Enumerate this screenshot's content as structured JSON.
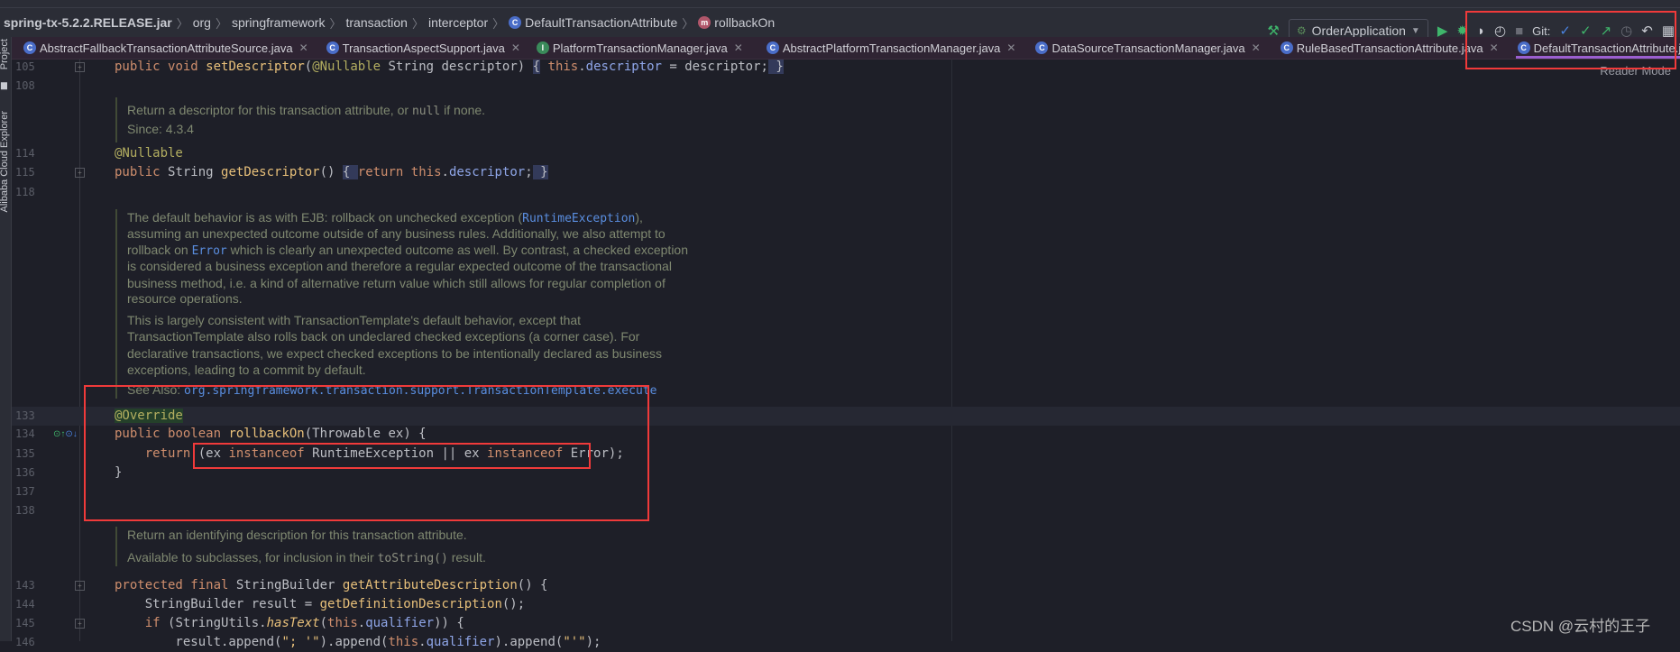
{
  "breadcrumb": {
    "jar": "spring-tx-5.2.2.RELEASE.jar",
    "parts": [
      "org",
      "springframework",
      "transaction",
      "interceptor"
    ],
    "class_name": "DefaultTransactionAttribute",
    "method_name": "rollbackOn"
  },
  "toolbar": {
    "run_config": "OrderApplication",
    "git_label": "Git:",
    "icons": [
      "build-hammer-icon",
      "run-icon",
      "debug-icon",
      "coverage-icon",
      "profile-icon",
      "stop-icon",
      "git-update-icon",
      "git-commit-icon",
      "git-push-icon",
      "history-icon",
      "rollback-icon",
      "project-structure-icon"
    ]
  },
  "tabs": [
    {
      "label": "AbstractFallbackTransactionAttributeSource.java",
      "kind": "C"
    },
    {
      "label": "TransactionAspectSupport.java",
      "kind": "C"
    },
    {
      "label": "PlatformTransactionManager.java",
      "kind": "I"
    },
    {
      "label": "AbstractPlatformTransactionManager.java",
      "kind": "C"
    },
    {
      "label": "DataSourceTransactionManager.java",
      "kind": "C"
    },
    {
      "label": "RuleBasedTransactionAttribute.java",
      "kind": "C"
    },
    {
      "label": "DefaultTransactionAttribute.java",
      "kind": "C",
      "active": true
    }
  ],
  "side_panels": [
    "Project",
    "Alibaba Cloud Explorer"
  ],
  "reader_mode": "Reader Mode",
  "code_lines": [
    {
      "n": "105",
      "fold": true,
      "tokens": [
        [
          "public ",
          "kw"
        ],
        [
          "void ",
          "kw"
        ],
        [
          "setDescriptor",
          "fn"
        ],
        [
          "(",
          "pl"
        ],
        [
          "@Nullable ",
          "an"
        ],
        [
          "String descriptor) ",
          "pl"
        ],
        [
          "{",
          "br"
        ],
        [
          " ",
          "pl"
        ],
        [
          "this",
          "kw"
        ],
        [
          ".",
          "pl"
        ],
        [
          "descriptor",
          "fld"
        ],
        [
          " = descriptor;",
          "pl"
        ],
        [
          " }",
          "br"
        ]
      ]
    },
    {
      "n": "108",
      "tokens": []
    },
    {
      "n": "114",
      "tokens": [
        [
          "@Nullable",
          "an"
        ]
      ]
    },
    {
      "n": "115",
      "fold": true,
      "tokens": [
        [
          "public ",
          "kw"
        ],
        [
          "String ",
          "pl"
        ],
        [
          "getDescriptor",
          "fn"
        ],
        [
          "() ",
          "pl"
        ],
        [
          "{ ",
          "br"
        ],
        [
          "return ",
          "kw"
        ],
        [
          "this",
          "kw"
        ],
        [
          ".",
          "pl"
        ],
        [
          "descriptor",
          "fld"
        ],
        [
          ";",
          "pl"
        ],
        [
          " }",
          "br"
        ]
      ]
    },
    {
      "n": "118",
      "tokens": []
    },
    {
      "n": "133",
      "current": true,
      "tokens": [
        [
          "@Override",
          "ov"
        ]
      ]
    },
    {
      "n": "134",
      "tokens": [
        [
          "public ",
          "kw"
        ],
        [
          "boolean ",
          "kw"
        ],
        [
          "rollbackOn",
          "fn"
        ],
        [
          "(Throwable ex) {",
          "pl"
        ]
      ]
    },
    {
      "n": "135",
      "tokens": [
        [
          "    return ",
          "kw"
        ],
        [
          "(ex ",
          "pl"
        ],
        [
          "instanceof ",
          "kw"
        ],
        [
          "RuntimeException || ex ",
          "pl"
        ],
        [
          "instanceof ",
          "kw"
        ],
        [
          "Error);",
          "pl"
        ]
      ]
    },
    {
      "n": "136",
      "tokens": [
        [
          "}",
          "pl"
        ]
      ]
    },
    {
      "n": "137",
      "tokens": []
    },
    {
      "n": "138",
      "tokens": []
    },
    {
      "n": "143",
      "fold": true,
      "tokens": [
        [
          "protected ",
          "kw"
        ],
        [
          "final ",
          "kw"
        ],
        [
          "StringBuilder ",
          "pl"
        ],
        [
          "getAttributeDescription",
          "fn"
        ],
        [
          "() {",
          "pl"
        ]
      ]
    },
    {
      "n": "144",
      "tokens": [
        [
          "    StringBuilder result = ",
          "pl"
        ],
        [
          "getDefinitionDescription",
          "fn"
        ],
        [
          "();",
          "pl"
        ]
      ]
    },
    {
      "n": "145",
      "fold": true,
      "tokens": [
        [
          "    if ",
          "kw"
        ],
        [
          "(StringUtils.",
          "pl"
        ],
        [
          "hasText",
          "it"
        ],
        [
          "(",
          "pl"
        ],
        [
          "this",
          "kw"
        ],
        [
          ".",
          "pl"
        ],
        [
          "qualifier",
          "fld"
        ],
        [
          ")) {",
          "pl"
        ]
      ]
    },
    {
      "n": "146",
      "tokens": [
        [
          "        result.append(",
          "pl"
        ],
        [
          "\"; '\"",
          "fn"
        ],
        [
          ").append(",
          "pl"
        ],
        [
          "this",
          "kw"
        ],
        [
          ".",
          "pl"
        ],
        [
          "qualifier",
          "fld"
        ],
        [
          ").append(",
          "pl"
        ],
        [
          "\"'\"",
          "fn"
        ],
        [
          ");",
          "pl"
        ]
      ]
    }
  ],
  "doc_lines": [
    [
      [
        "Return a descriptor for this transaction attribute, or ",
        ""
      ],
      [
        "null",
        "dcode"
      ],
      [
        " if none.",
        ""
      ]
    ],
    [
      [
        "Since: 4.3.4",
        ""
      ]
    ],
    [
      [
        "The default behavior is as with EJB: rollback on unchecked exception (",
        ""
      ],
      [
        "RuntimeException",
        "dlink"
      ],
      [
        "),",
        ""
      ]
    ],
    [
      [
        "assuming an unexpected outcome outside of any business rules. Additionally, we also attempt to",
        ""
      ]
    ],
    [
      [
        "rollback on ",
        ""
      ],
      [
        "Error",
        "dlink"
      ],
      [
        " which is clearly an unexpected outcome as well. By contrast, a checked exception",
        ""
      ]
    ],
    [
      [
        "is considered a business exception and therefore a regular expected outcome of the transactional",
        ""
      ]
    ],
    [
      [
        "business method, i.e. a kind of alternative return value which still allows for regular completion of",
        ""
      ]
    ],
    [
      [
        "resource operations.",
        ""
      ]
    ],
    [
      [
        "This is largely consistent with TransactionTemplate's default behavior, except that",
        ""
      ]
    ],
    [
      [
        "TransactionTemplate also rolls back on undeclared checked exceptions (a corner case). For",
        ""
      ]
    ],
    [
      [
        "declarative transactions, we expect checked exceptions to be intentionally declared as business",
        ""
      ]
    ],
    [
      [
        "exceptions, leading to a commit by default.",
        ""
      ]
    ],
    [
      [
        "See Also: ",
        ""
      ],
      [
        "org.springframework.transaction.support.TransactionTemplate.execute",
        "dlink"
      ]
    ],
    [
      [
        "Return an identifying description for this transaction attribute.",
        ""
      ]
    ],
    [
      [
        "Available to subclasses, for inclusion in their ",
        ""
      ],
      [
        "toString()",
        "dcode"
      ],
      [
        " result.",
        ""
      ]
    ]
  ],
  "watermark": "CSDN @云村的王子",
  "colors": {
    "highlight_box": "#f03a3a",
    "active_tab_underline": "#9b5fd0",
    "editor_bg": "#1e1f28"
  }
}
